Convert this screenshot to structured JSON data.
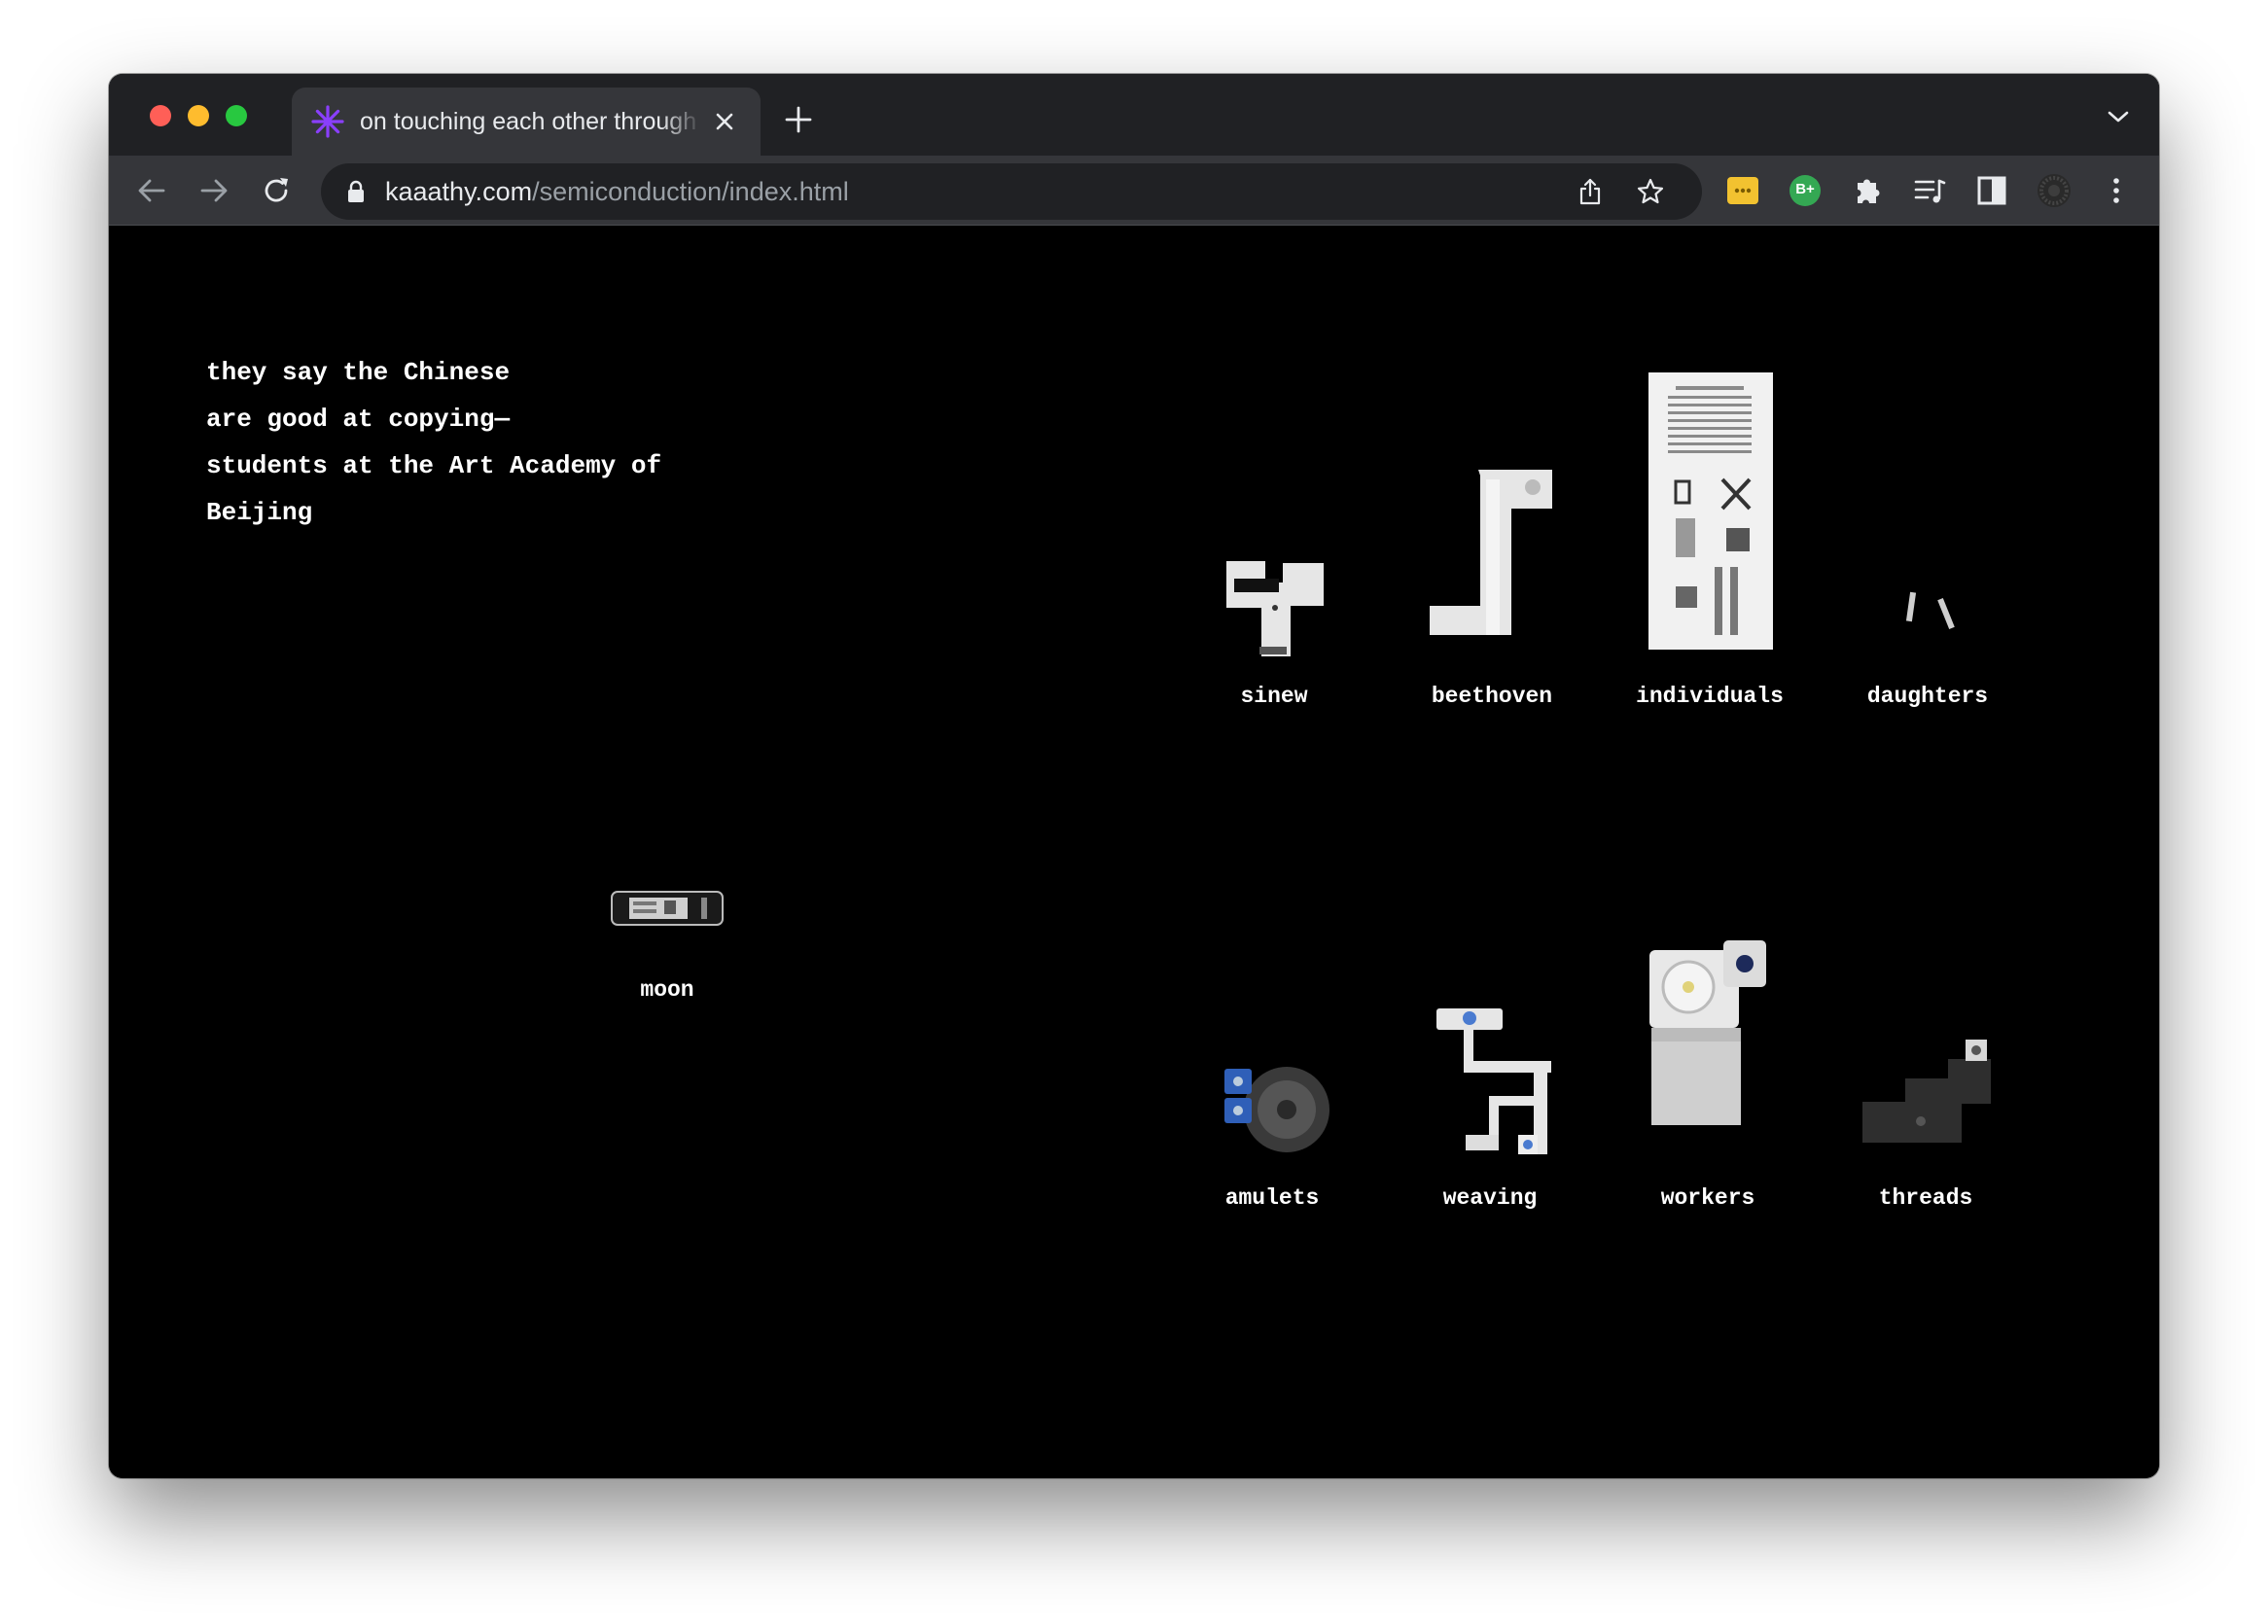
{
  "browser": {
    "tab_title": "on touching each other through our differences",
    "url_domain": "kaaathy.com",
    "url_path": "/semiconduction/index.html",
    "extension_badge": "B+"
  },
  "page": {
    "intro_lines": [
      "they say the Chinese",
      "are good at copying—",
      "students at the Art Academy of",
      "Beijing"
    ],
    "items": {
      "sinew": "sinew",
      "beethoven": "beethoven",
      "individuals": "individuals",
      "daughters": "daughters",
      "moon": "moon",
      "amulets": "amulets",
      "weaving": "weaving",
      "workers": "workers",
      "threads": "threads"
    }
  },
  "colors": {
    "favicon": "#8a3ffc",
    "page_background": "#000000",
    "text": "#ffffff"
  }
}
